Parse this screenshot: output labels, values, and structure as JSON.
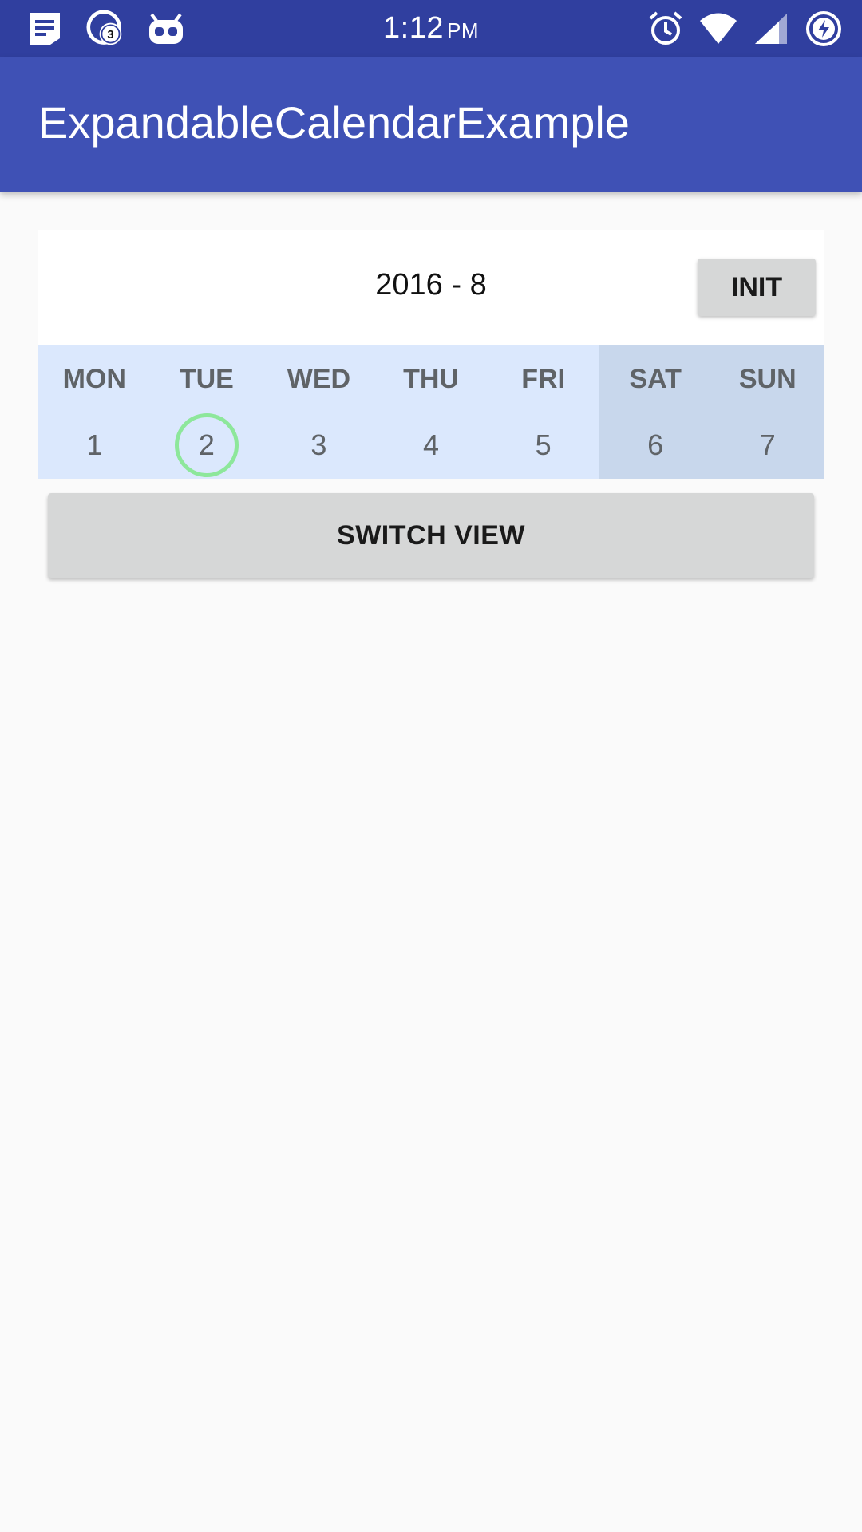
{
  "status_bar": {
    "time": "1:12",
    "ampm": "PM",
    "left_icons": [
      "notes-icon",
      "messenger-badge-icon",
      "cyanogen-robot-icon"
    ],
    "badge_count": "3",
    "right_icons": [
      "alarm-icon",
      "wifi-icon",
      "cell-signal-icon",
      "battery-charging-icon"
    ]
  },
  "app_bar": {
    "title": "ExpandableCalendarExample",
    "color": "#3f51b5"
  },
  "calendar": {
    "month_label": "2016 - 8",
    "init_label": "INIT",
    "days": [
      {
        "name": "MON",
        "num": "1",
        "weekend": false,
        "selected": false
      },
      {
        "name": "TUE",
        "num": "2",
        "weekend": false,
        "selected": true
      },
      {
        "name": "WED",
        "num": "3",
        "weekend": false,
        "selected": false
      },
      {
        "name": "THU",
        "num": "4",
        "weekend": false,
        "selected": false
      },
      {
        "name": "FRI",
        "num": "5",
        "weekend": false,
        "selected": false
      },
      {
        "name": "SAT",
        "num": "6",
        "weekend": true,
        "selected": false
      },
      {
        "name": "SUN",
        "num": "7",
        "weekend": true,
        "selected": false
      }
    ],
    "weekday_color": "#dbe8fd",
    "weekend_color": "#c8d7ec",
    "selected_ring_color": "#8de79b"
  },
  "switch_view_label": "SWITCH VIEW"
}
